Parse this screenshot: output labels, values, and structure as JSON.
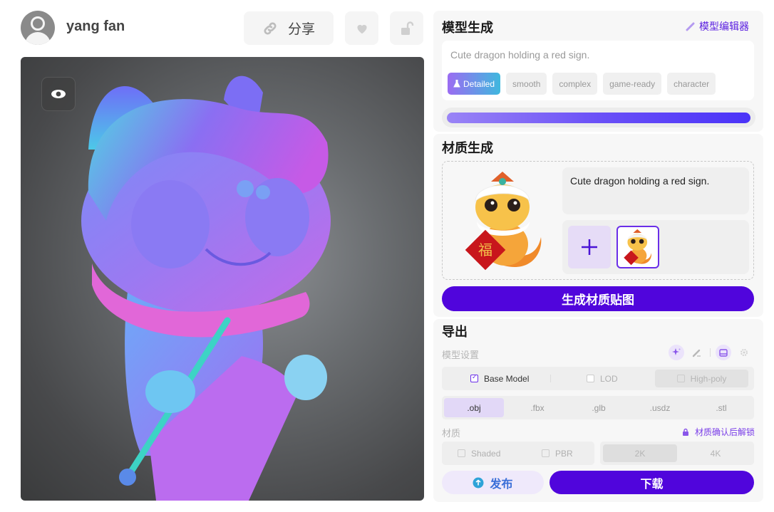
{
  "user": {
    "name": "yang fan",
    "avatar_icon": "default-user-avatar"
  },
  "header": {
    "share_label": "分享",
    "share_icon": "link-icon",
    "like_icon": "heart-icon",
    "lock_icon": "unlock-icon"
  },
  "viewer": {
    "eye_icon": "eye-icon"
  },
  "model_gen": {
    "title": "模型生成",
    "editor_link": "模型编辑器",
    "prompt": "Cute dragon holding a red sign.",
    "chips": [
      {
        "label": "Detailed",
        "active": true,
        "icon": "flask-icon"
      },
      {
        "label": "smooth",
        "active": false
      },
      {
        "label": "complex",
        "active": false
      },
      {
        "label": "game-ready",
        "active": false
      },
      {
        "label": "character",
        "active": false
      }
    ],
    "progress": 1.0
  },
  "material_gen": {
    "title": "材质生成",
    "prompt": "Cute dragon holding a red sign.",
    "add_icon": "plus-icon",
    "generate_label": "生成材质贴图"
  },
  "export": {
    "title": "导出",
    "model_settings_label": "模型设置",
    "model_options": [
      {
        "label": "Base Model",
        "checked": true
      },
      {
        "label": "LOD",
        "checked": false
      },
      {
        "label": "High-poly",
        "checked": false
      }
    ],
    "formats": [
      ".obj",
      ".fbx",
      ".glb",
      ".usdz",
      ".stl"
    ],
    "selected_format": ".obj",
    "material_label": "材质",
    "lock_note": "材质确认后解锁",
    "shading_options": [
      {
        "label": "Shaded",
        "checked": false
      },
      {
        "label": "PBR",
        "checked": false
      }
    ],
    "resolutions": [
      "2K",
      "4K"
    ],
    "selected_resolution": "2K",
    "publish_label": "发布",
    "download_label": "下载"
  },
  "colors": {
    "accent": "#5005dc",
    "accent_light": "#e6dcf7",
    "link": "#5a1ee0"
  }
}
